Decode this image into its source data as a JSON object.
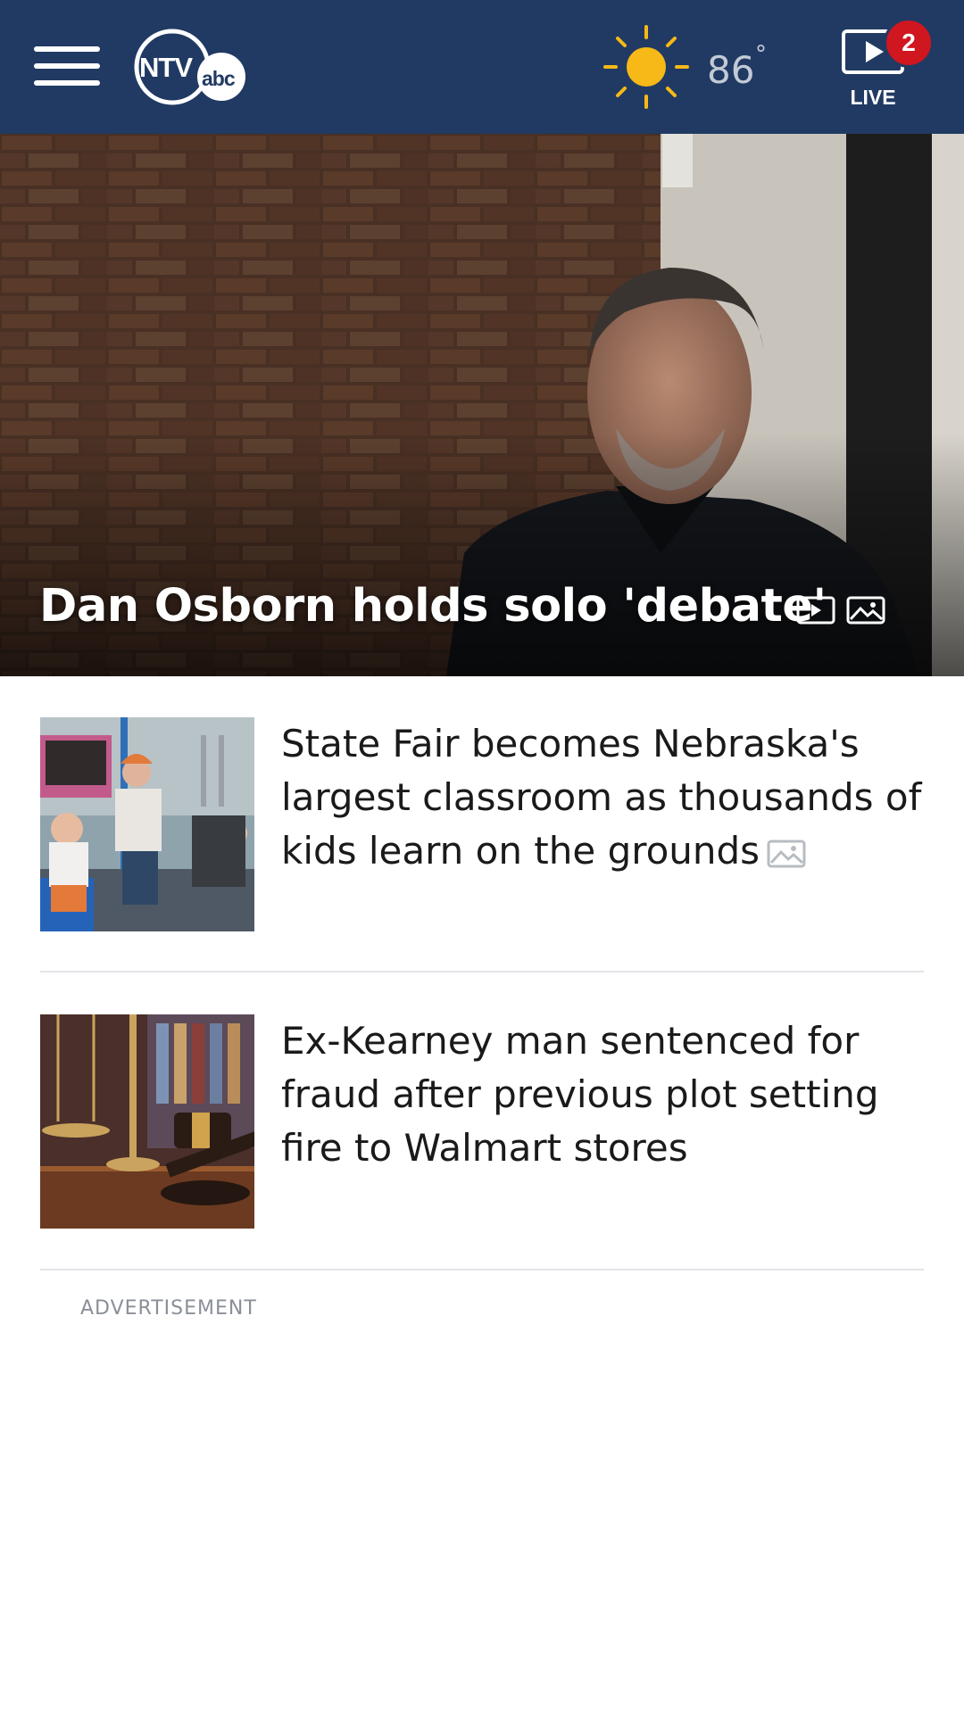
{
  "header": {
    "menu_icon": "hamburger-menu-icon",
    "logo_text": "NTV",
    "logo_sub": "abc",
    "weather": {
      "icon": "sun-icon",
      "temperature": "86",
      "degree_symbol": "°"
    },
    "live": {
      "icon": "play-video-icon",
      "label": "LIVE",
      "badge_count": "2"
    }
  },
  "hero": {
    "title": "Dan Osborn holds solo 'debate'",
    "icons": [
      "video-icon",
      "photo-gallery-icon"
    ]
  },
  "stories": [
    {
      "headline": "State Fair becomes Nebraska's largest classroom as thousands of kids learn on the grounds",
      "icon": "photo-gallery-icon"
    },
    {
      "headline": "Ex-Kearney man sentenced for fraud after previous plot setting fire to Walmart stores"
    }
  ],
  "ad": {
    "label": "ADVERTISEMENT"
  },
  "colors": {
    "header_bg": "#213a63",
    "badge": "#d0161f",
    "sun": "#f6b917",
    "divider": "#e2e4e8"
  }
}
